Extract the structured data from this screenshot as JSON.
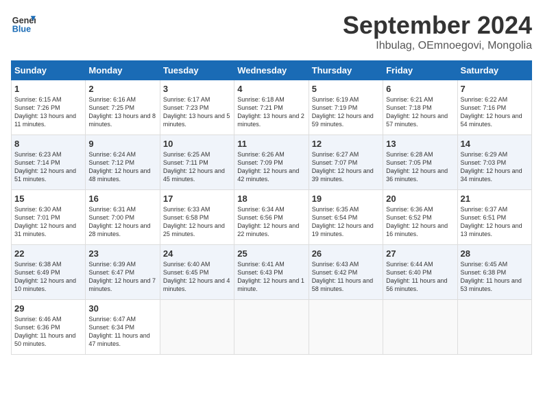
{
  "header": {
    "logo_line1": "General",
    "logo_line2": "Blue",
    "month": "September 2024",
    "location": "Ihbulag, OEmnoegovi, Mongolia"
  },
  "weekdays": [
    "Sunday",
    "Monday",
    "Tuesday",
    "Wednesday",
    "Thursday",
    "Friday",
    "Saturday"
  ],
  "weeks": [
    [
      {
        "day": "1",
        "sunrise": "6:15 AM",
        "sunset": "7:26 PM",
        "daylight": "13 hours and 11 minutes."
      },
      {
        "day": "2",
        "sunrise": "6:16 AM",
        "sunset": "7:25 PM",
        "daylight": "13 hours and 8 minutes."
      },
      {
        "day": "3",
        "sunrise": "6:17 AM",
        "sunset": "7:23 PM",
        "daylight": "13 hours and 5 minutes."
      },
      {
        "day": "4",
        "sunrise": "6:18 AM",
        "sunset": "7:21 PM",
        "daylight": "13 hours and 2 minutes."
      },
      {
        "day": "5",
        "sunrise": "6:19 AM",
        "sunset": "7:19 PM",
        "daylight": "12 hours and 59 minutes."
      },
      {
        "day": "6",
        "sunrise": "6:21 AM",
        "sunset": "7:18 PM",
        "daylight": "12 hours and 57 minutes."
      },
      {
        "day": "7",
        "sunrise": "6:22 AM",
        "sunset": "7:16 PM",
        "daylight": "12 hours and 54 minutes."
      }
    ],
    [
      {
        "day": "8",
        "sunrise": "6:23 AM",
        "sunset": "7:14 PM",
        "daylight": "12 hours and 51 minutes."
      },
      {
        "day": "9",
        "sunrise": "6:24 AM",
        "sunset": "7:12 PM",
        "daylight": "12 hours and 48 minutes."
      },
      {
        "day": "10",
        "sunrise": "6:25 AM",
        "sunset": "7:11 PM",
        "daylight": "12 hours and 45 minutes."
      },
      {
        "day": "11",
        "sunrise": "6:26 AM",
        "sunset": "7:09 PM",
        "daylight": "12 hours and 42 minutes."
      },
      {
        "day": "12",
        "sunrise": "6:27 AM",
        "sunset": "7:07 PM",
        "daylight": "12 hours and 39 minutes."
      },
      {
        "day": "13",
        "sunrise": "6:28 AM",
        "sunset": "7:05 PM",
        "daylight": "12 hours and 36 minutes."
      },
      {
        "day": "14",
        "sunrise": "6:29 AM",
        "sunset": "7:03 PM",
        "daylight": "12 hours and 34 minutes."
      }
    ],
    [
      {
        "day": "15",
        "sunrise": "6:30 AM",
        "sunset": "7:01 PM",
        "daylight": "12 hours and 31 minutes."
      },
      {
        "day": "16",
        "sunrise": "6:31 AM",
        "sunset": "7:00 PM",
        "daylight": "12 hours and 28 minutes."
      },
      {
        "day": "17",
        "sunrise": "6:33 AM",
        "sunset": "6:58 PM",
        "daylight": "12 hours and 25 minutes."
      },
      {
        "day": "18",
        "sunrise": "6:34 AM",
        "sunset": "6:56 PM",
        "daylight": "12 hours and 22 minutes."
      },
      {
        "day": "19",
        "sunrise": "6:35 AM",
        "sunset": "6:54 PM",
        "daylight": "12 hours and 19 minutes."
      },
      {
        "day": "20",
        "sunrise": "6:36 AM",
        "sunset": "6:52 PM",
        "daylight": "12 hours and 16 minutes."
      },
      {
        "day": "21",
        "sunrise": "6:37 AM",
        "sunset": "6:51 PM",
        "daylight": "12 hours and 13 minutes."
      }
    ],
    [
      {
        "day": "22",
        "sunrise": "6:38 AM",
        "sunset": "6:49 PM",
        "daylight": "12 hours and 10 minutes."
      },
      {
        "day": "23",
        "sunrise": "6:39 AM",
        "sunset": "6:47 PM",
        "daylight": "12 hours and 7 minutes."
      },
      {
        "day": "24",
        "sunrise": "6:40 AM",
        "sunset": "6:45 PM",
        "daylight": "12 hours and 4 minutes."
      },
      {
        "day": "25",
        "sunrise": "6:41 AM",
        "sunset": "6:43 PM",
        "daylight": "12 hours and 1 minute."
      },
      {
        "day": "26",
        "sunrise": "6:43 AM",
        "sunset": "6:42 PM",
        "daylight": "11 hours and 58 minutes."
      },
      {
        "day": "27",
        "sunrise": "6:44 AM",
        "sunset": "6:40 PM",
        "daylight": "11 hours and 56 minutes."
      },
      {
        "day": "28",
        "sunrise": "6:45 AM",
        "sunset": "6:38 PM",
        "daylight": "11 hours and 53 minutes."
      }
    ],
    [
      {
        "day": "29",
        "sunrise": "6:46 AM",
        "sunset": "6:36 PM",
        "daylight": "11 hours and 50 minutes."
      },
      {
        "day": "30",
        "sunrise": "6:47 AM",
        "sunset": "6:34 PM",
        "daylight": "11 hours and 47 minutes."
      },
      null,
      null,
      null,
      null,
      null
    ]
  ]
}
